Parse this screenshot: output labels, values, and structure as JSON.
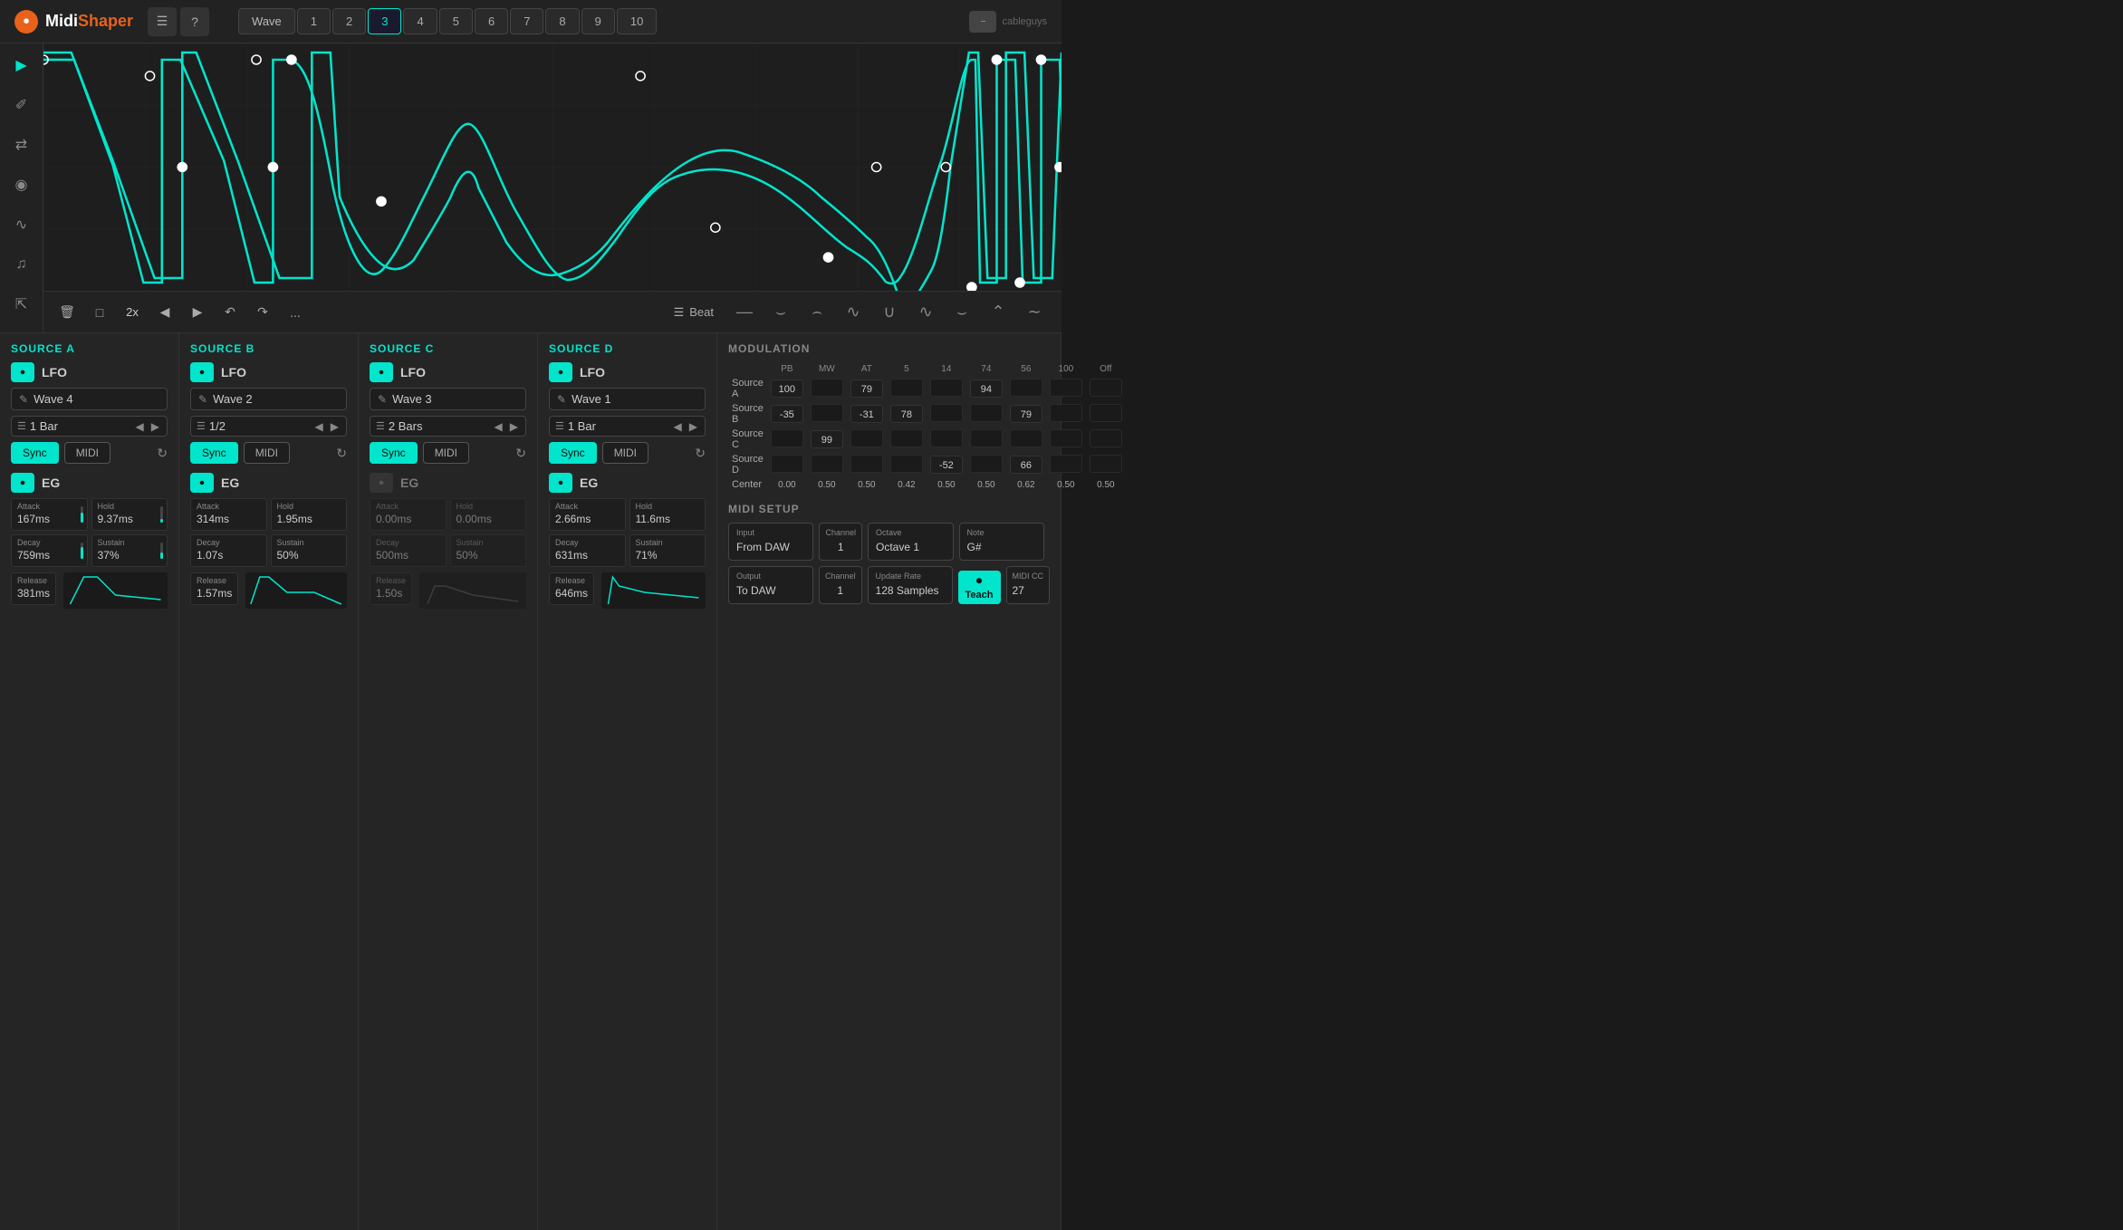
{
  "app": {
    "name_prefix": "Midi",
    "name_suffix": "Shaper",
    "brand": "cableguys"
  },
  "header": {
    "tabs": [
      {
        "label": "Wave",
        "id": "wave",
        "active": false
      },
      {
        "label": "1",
        "id": "1",
        "active": false
      },
      {
        "label": "2",
        "id": "2",
        "active": false
      },
      {
        "label": "3",
        "id": "3",
        "active": true
      },
      {
        "label": "4",
        "id": "4",
        "active": false
      },
      {
        "label": "5",
        "id": "5",
        "active": false
      },
      {
        "label": "6",
        "id": "6",
        "active": false
      },
      {
        "label": "7",
        "id": "7",
        "active": false
      },
      {
        "label": "8",
        "id": "8",
        "active": false
      },
      {
        "label": "9",
        "id": "9",
        "active": false
      },
      {
        "label": "10",
        "id": "10",
        "active": false
      }
    ]
  },
  "toolbar": {
    "zoom": "2x",
    "beat_label": "Beat",
    "more": "..."
  },
  "sources": {
    "a": {
      "title": "SOURCE A",
      "lfo_label": "LFO",
      "lfo_on": true,
      "wave_name": "Wave 4",
      "rate": "1 Bar",
      "sync_active": true,
      "midi_label": "MIDI",
      "eg_on": true,
      "eg_label": "EG",
      "attack": "167ms",
      "hold": "9.37ms",
      "decay": "759ms",
      "sustain": "37%",
      "release": "381ms"
    },
    "b": {
      "title": "SOURCE B",
      "lfo_label": "LFO",
      "lfo_on": true,
      "wave_name": "Wave 2",
      "rate": "1/2",
      "sync_active": true,
      "midi_label": "MIDI",
      "eg_on": true,
      "eg_label": "EG",
      "attack": "314ms",
      "hold": "1.95ms",
      "decay": "1.07s",
      "sustain": "50%",
      "release": "1.57ms"
    },
    "c": {
      "title": "SOURCE C",
      "lfo_label": "LFO",
      "lfo_on": true,
      "wave_name": "Wave 3",
      "rate": "2 Bars",
      "sync_active": true,
      "midi_label": "MIDI",
      "eg_on": false,
      "eg_label": "EG",
      "attack": "0.00ms",
      "hold": "0.00ms",
      "decay": "500ms",
      "sustain": "50%",
      "release": "1.50s"
    },
    "d": {
      "title": "SOURCE D",
      "lfo_label": "LFO",
      "lfo_on": true,
      "wave_name": "Wave 1",
      "rate": "1 Bar",
      "sync_active": true,
      "midi_label": "MIDI",
      "eg_on": true,
      "eg_label": "EG",
      "attack": "2.66ms",
      "hold": "11.6ms",
      "decay": "631ms",
      "sustain": "71%",
      "release": "646ms"
    }
  },
  "modulation": {
    "title": "MODULATION",
    "columns": [
      "PB",
      "MW",
      "AT",
      "5",
      "14",
      "74",
      "56",
      "100",
      "Off"
    ],
    "rows": [
      {
        "label": "Source A",
        "values": {
          "PB": "100",
          "MW": "",
          "AT": "79",
          "5": "",
          "14": "",
          "74": "94",
          "56": "",
          "100": "",
          "Off": ""
        }
      },
      {
        "label": "Source B",
        "values": {
          "PB": "-35",
          "MW": "",
          "AT": "-31",
          "5": "78",
          "14": "",
          "74": "",
          "56": "79",
          "100": "",
          "Off": ""
        }
      },
      {
        "label": "Source C",
        "values": {
          "PB": "",
          "MW": "99",
          "AT": "",
          "5": "",
          "14": "",
          "74": "",
          "56": "",
          "100": "",
          "Off": ""
        }
      },
      {
        "label": "Source D",
        "values": {
          "PB": "",
          "MW": "",
          "AT": "",
          "5": "",
          "14": "-52",
          "74": "",
          "56": "66",
          "100": "",
          "Off": ""
        }
      }
    ],
    "center_row": {
      "label": "Center",
      "values": [
        "0.00",
        "0.50",
        "0.50",
        "0.42",
        "0.50",
        "0.50",
        "0.62",
        "0.50",
        "0.50"
      ]
    }
  },
  "midi_setup": {
    "title": "MIDI SETUP",
    "input_label": "Input",
    "input_value": "From DAW",
    "input_channel_label": "Channel",
    "input_channel_value": "1",
    "octave_label": "Octave",
    "octave_value": "Octave 1",
    "note_label": "Note",
    "note_value": "G#",
    "output_label": "Output",
    "output_value": "To DAW",
    "output_channel_label": "Channel",
    "output_channel_value": "1",
    "update_rate_label": "Update Rate",
    "update_rate_value": "128 Samples",
    "teach_label": "Teach",
    "midi_cc_label": "MIDI CC",
    "midi_cc_value": "27"
  }
}
